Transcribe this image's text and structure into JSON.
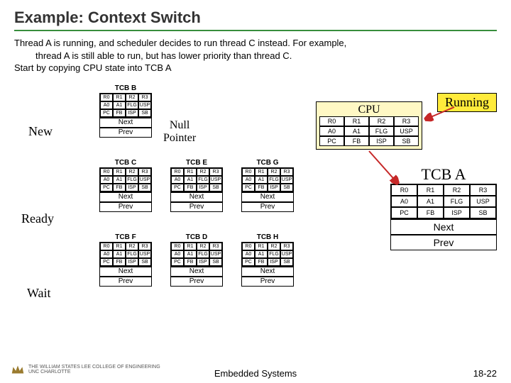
{
  "title": "Example: Context Switch",
  "desc_l1": "Thread A is running, and scheduler decides to run thread C instead. For example,",
  "desc_l2": "thread A is still able to run, but has lower priority than thread C.",
  "desc_l3": "Start by copying CPU state into TCB A",
  "states": {
    "new": "New",
    "ready": "Ready",
    "wait": "Wait"
  },
  "regs": [
    "R0",
    "R1",
    "R2",
    "R3",
    "A0",
    "A1",
    "FLG",
    "USP",
    "PC",
    "FB",
    "ISP",
    "SB"
  ],
  "next": "Next",
  "prev": "Prev",
  "tcb": {
    "b": "TCB B",
    "c": "TCB C",
    "e": "TCB E",
    "g": "TCB G",
    "f": "TCB F",
    "d": "TCB D",
    "h": "TCB H"
  },
  "null_l1": "Null",
  "null_l2": "Pointer",
  "cpu_title": "CPU",
  "running": "Running",
  "tcba_title": "TCB A",
  "footer_center": "Embedded Systems",
  "footer_right": "18-22",
  "logo_l1": "THE WILLIAM STATES LEE COLLEGE OF ENGINEERING",
  "logo_l2": "UNC CHARLOTTE"
}
